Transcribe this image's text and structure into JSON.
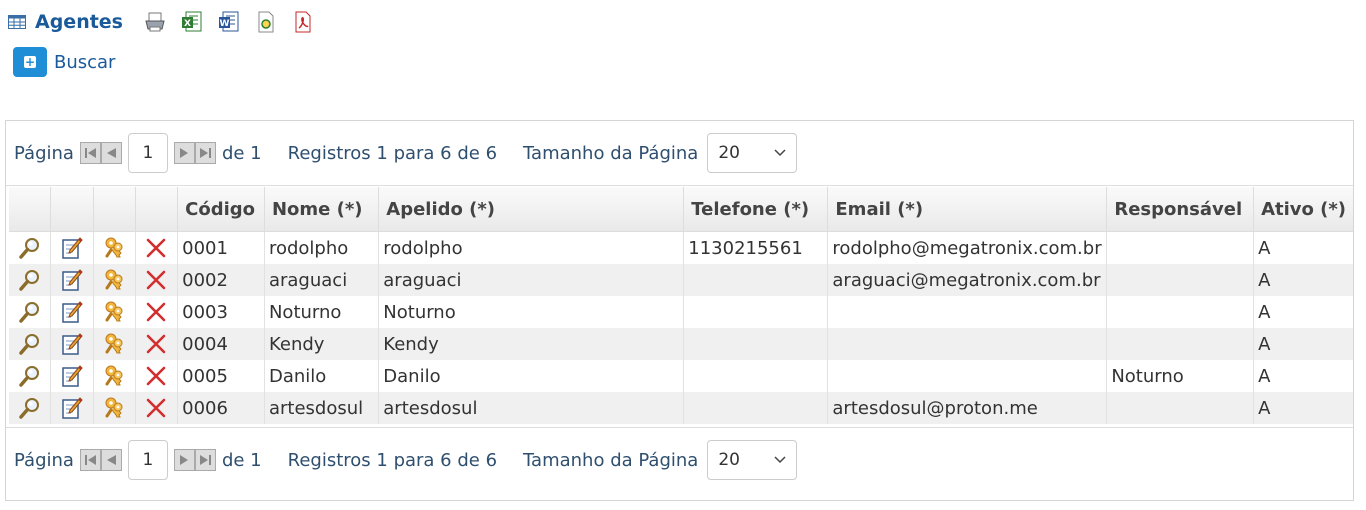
{
  "header": {
    "title": "Agentes",
    "table_icon": "table-icon",
    "exports": [
      {
        "name": "print-icon"
      },
      {
        "name": "excel-export-icon"
      },
      {
        "name": "word-export-icon"
      },
      {
        "name": "csv-export-icon"
      },
      {
        "name": "pdf-export-icon"
      }
    ]
  },
  "search_button": {
    "label": "Buscar",
    "icon": "plus-icon",
    "color": "#1f8ed6"
  },
  "pager": {
    "page_label": "Página",
    "current_page": "1",
    "of_label": "de 1",
    "records": "Registros 1 para 6 de 6",
    "page_size_label": "Tamanho da Página",
    "page_size": "20"
  },
  "table": {
    "columns": [
      "Código",
      "Nome (*)",
      "Apelido (*)",
      "Telefone (*)",
      "Email (*)",
      "Responsável",
      "Ativo (*)"
    ],
    "action_icons": [
      "view-icon",
      "edit-icon",
      "permissions-icon",
      "delete-icon"
    ],
    "rows": [
      {
        "codigo": "0001",
        "nome": "rodolpho",
        "apelido": "rodolpho",
        "telefone": "1130215561",
        "email": "rodolpho@megatronix.com.br",
        "responsavel": "",
        "ativo": "A"
      },
      {
        "codigo": "0002",
        "nome": "araguaci",
        "apelido": "araguaci",
        "telefone": "",
        "email": "araguaci@megatronix.com.br",
        "responsavel": "",
        "ativo": "A"
      },
      {
        "codigo": "0003",
        "nome": "Noturno",
        "apelido": "Noturno",
        "telefone": "",
        "email": "",
        "responsavel": "",
        "ativo": "A"
      },
      {
        "codigo": "0004",
        "nome": "Kendy",
        "apelido": "Kendy",
        "telefone": "",
        "email": "",
        "responsavel": "",
        "ativo": "A"
      },
      {
        "codigo": "0005",
        "nome": "Danilo",
        "apelido": "Danilo",
        "telefone": "",
        "email": "",
        "responsavel": "Noturno",
        "ativo": "A"
      },
      {
        "codigo": "0006",
        "nome": "artesdosul",
        "apelido": "artesdosul",
        "telefone": "",
        "email": "artesdosul@proton.me",
        "responsavel": "",
        "ativo": "A"
      }
    ]
  }
}
